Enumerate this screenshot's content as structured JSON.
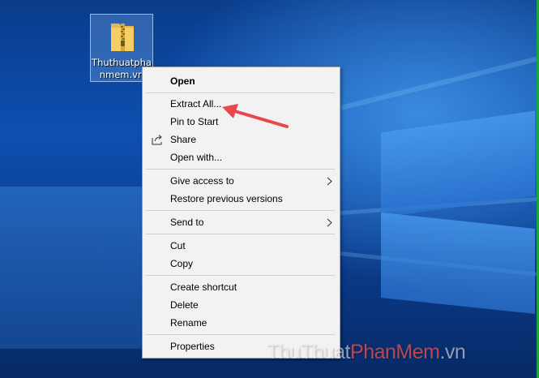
{
  "desktop": {
    "icon": {
      "name": "Thuthuatphanmem.vn",
      "name_line1": "Thuthuatpha",
      "name_line2": "nmem.vn"
    }
  },
  "context_menu": {
    "items": [
      {
        "label": "Open",
        "bold": true
      },
      {
        "label": "Extract All..."
      },
      {
        "label": "Pin to Start"
      },
      {
        "label": "Share"
      },
      {
        "label": "Open with..."
      },
      {
        "label": "Give access to",
        "submenu": true
      },
      {
        "label": "Restore previous versions"
      },
      {
        "label": "Send to",
        "submenu": true
      },
      {
        "label": "Cut"
      },
      {
        "label": "Copy"
      },
      {
        "label": "Create shortcut"
      },
      {
        "label": "Delete"
      },
      {
        "label": "Rename"
      },
      {
        "label": "Properties"
      }
    ]
  },
  "annotation": {
    "color": "#e8474d"
  },
  "watermark": {
    "part1": "ThuThuat",
    "part2": "PhanMem",
    "part3": ".vn"
  },
  "colors": {
    "menu_bg": "#f2f2f2",
    "separator": "#cfcfcf",
    "accent_frame": "#19a83a"
  }
}
